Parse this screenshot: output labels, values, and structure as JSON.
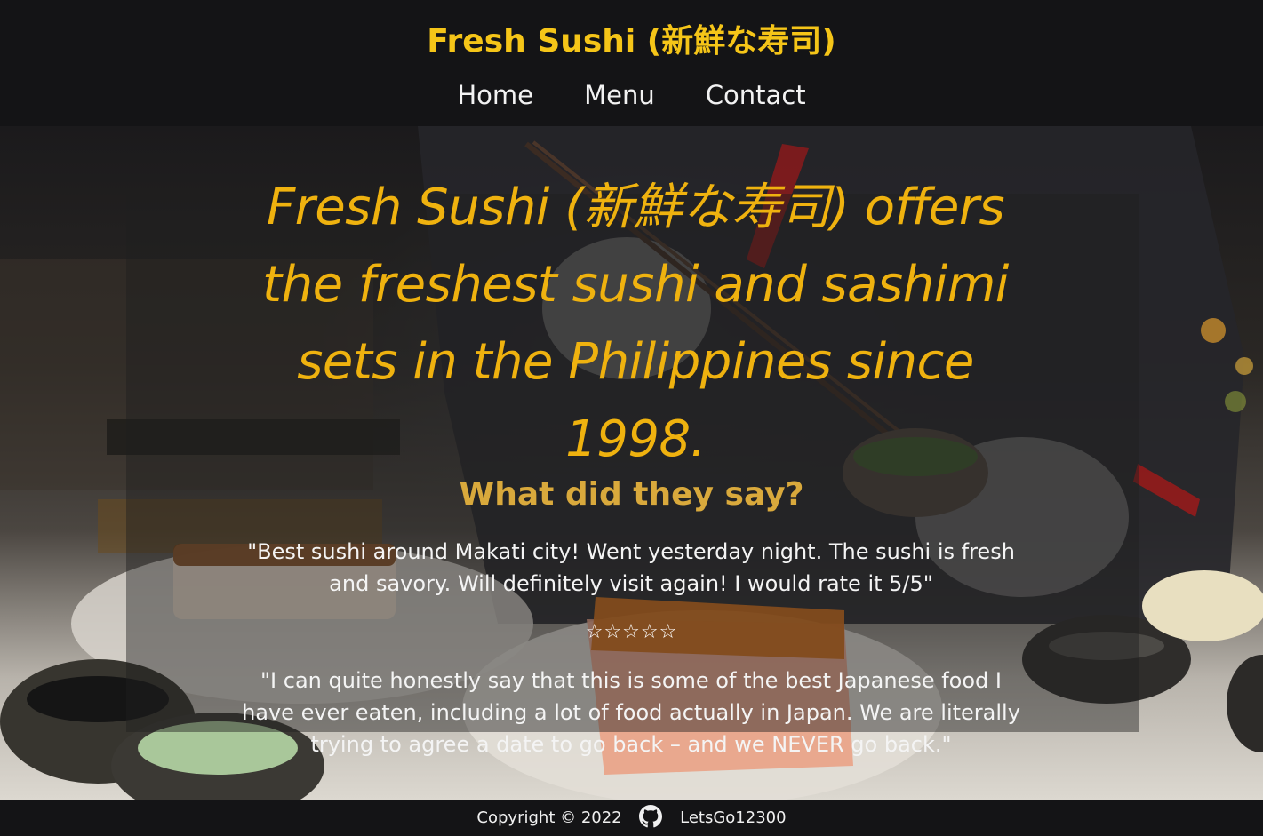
{
  "header": {
    "brand": "Fresh Sushi (新鮮な寿司)",
    "nav": [
      {
        "label": "Home"
      },
      {
        "label": "Menu"
      },
      {
        "label": "Contact"
      }
    ]
  },
  "hero": {
    "tagline": "Fresh Sushi (新鮮な寿司) offers the freshest sushi and sashimi sets in the Philippines since 1998.",
    "reviews_heading": "What did they say?",
    "reviews": [
      {
        "text": "\"Best sushi around Makati city! Went yesterday night. The sushi is fresh and savory. Will definitely visit again! I would rate it 5/5\"",
        "rating": "☆☆☆☆☆"
      },
      {
        "text": "\"I can quite honestly say that this is some of the best Japanese food I have ever eaten, including a lot of food actually in Japan. We are literally trying to agree a date to go back – and we NEVER go back.\""
      }
    ]
  },
  "footer": {
    "copyright": "Copyright © 2022",
    "github_icon": "github-icon",
    "username": "LetsGo12300"
  },
  "colors": {
    "brand": "#f5c518",
    "tagline": "#efb20f",
    "heading": "#d9a93c",
    "bar": "#141416"
  }
}
